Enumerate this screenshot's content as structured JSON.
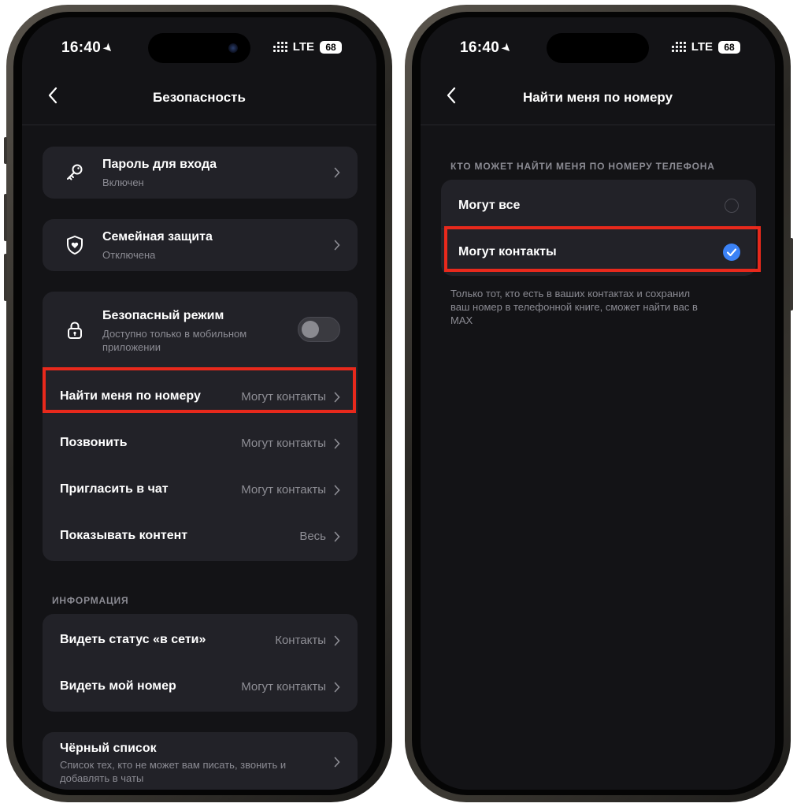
{
  "left_screen": {
    "status": {
      "time": "16:40",
      "network": "LTE",
      "battery": "68"
    },
    "header": {
      "title": "Безопасность"
    },
    "password": {
      "title": "Пароль для входа",
      "subtitle": "Включен"
    },
    "family": {
      "title": "Семейная защита",
      "subtitle": "Отключена"
    },
    "safe_mode": {
      "title": "Безопасный режим",
      "subtitle_line1": "Доступно только в мобильном",
      "subtitle_line2": "приложении"
    },
    "privacy_rows": [
      {
        "label": "Найти меня по номеру",
        "value": "Могут контакты"
      },
      {
        "label": "Позвонить",
        "value": "Могут контакты"
      },
      {
        "label": "Пригласить в чат",
        "value": "Могут контакты"
      },
      {
        "label": "Показывать контент",
        "value": "Весь"
      }
    ],
    "info_section": {
      "label": "ИНФОРМАЦИЯ",
      "rows": [
        {
          "label": "Видеть статус «в сети»",
          "value": "Контакты"
        },
        {
          "label": "Видеть мой номер",
          "value": "Могут контакты"
        }
      ]
    },
    "blacklist": {
      "title": "Чёрный список",
      "subtitle_line1": "Список тех, кто не может вам писать, звонить и",
      "subtitle_line2": "добавлять в чаты"
    }
  },
  "right_screen": {
    "status": {
      "time": "16:40",
      "network": "LTE",
      "battery": "68"
    },
    "header": {
      "title": "Найти меня по номеру"
    },
    "section_label": "КТО МОЖЕТ НАЙТИ МЕНЯ ПО НОМЕРУ ТЕЛЕФОНА",
    "options": [
      {
        "label": "Могут все",
        "selected": false
      },
      {
        "label": "Могут контакты",
        "selected": true
      }
    ],
    "helper_line1": "Только тот, кто есть в ваших контактах и сохранил",
    "helper_line2": "ваш номер в телефонной книге, сможет найти вас в",
    "helper_line3": "MAX"
  },
  "colors": {
    "highlight": "#e8291c",
    "accent": "#3b82f6",
    "card": "#222228",
    "screen_bg": "#131316"
  }
}
